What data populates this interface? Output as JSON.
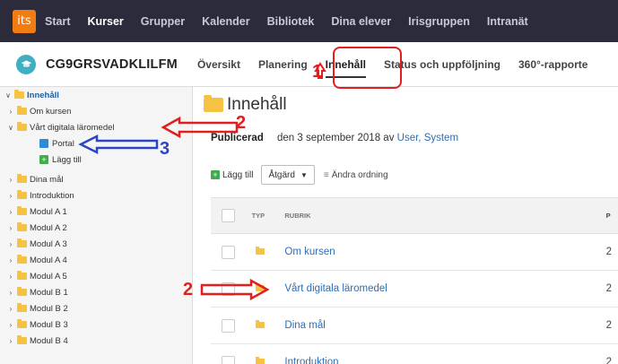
{
  "topnav": {
    "logo": "its",
    "items": [
      {
        "label": "Start",
        "active": false
      },
      {
        "label": "Kurser",
        "active": true
      },
      {
        "label": "Grupper",
        "active": false
      },
      {
        "label": "Kalender",
        "active": false
      },
      {
        "label": "Bibliotek",
        "active": false
      },
      {
        "label": "Dina elever",
        "active": false
      },
      {
        "label": "Irisgruppen",
        "active": false
      },
      {
        "label": "Intranät",
        "active": false
      }
    ]
  },
  "subnav": {
    "course_code": "CG9GRSVADKLILFM",
    "tabs": [
      {
        "label": "Översikt",
        "active": false
      },
      {
        "label": "Planering",
        "active": false
      },
      {
        "label": "Innehåll",
        "active": true
      },
      {
        "label": "Status och uppföljning",
        "active": false
      },
      {
        "label": "360°-rapporte",
        "active": false
      }
    ]
  },
  "sidebar": {
    "root": "Innehåll",
    "items": [
      {
        "label": "Om kursen",
        "indent": 1,
        "type": "folder",
        "expanded": false
      },
      {
        "label": "Vårt digitala läromedel",
        "indent": 1,
        "type": "folder",
        "expanded": true
      },
      {
        "label": "Portal",
        "indent": 2,
        "type": "portal"
      },
      {
        "label": "Lägg till",
        "indent": 2,
        "type": "add"
      },
      {
        "label": "Dina mål",
        "indent": 1,
        "type": "folder",
        "expanded": false
      },
      {
        "label": "Introduktion",
        "indent": 1,
        "type": "folder",
        "expanded": false
      },
      {
        "label": "Modul A 1",
        "indent": 1,
        "type": "folder",
        "expanded": false
      },
      {
        "label": "Modul A 2",
        "indent": 1,
        "type": "folder",
        "expanded": false
      },
      {
        "label": "Modul A 3",
        "indent": 1,
        "type": "folder",
        "expanded": false
      },
      {
        "label": "Modul A 4",
        "indent": 1,
        "type": "folder",
        "expanded": false
      },
      {
        "label": "Modul A 5",
        "indent": 1,
        "type": "folder",
        "expanded": false
      },
      {
        "label": "Modul B 1",
        "indent": 1,
        "type": "folder",
        "expanded": false
      },
      {
        "label": "Modul B 2",
        "indent": 1,
        "type": "folder",
        "expanded": false
      },
      {
        "label": "Modul B 3",
        "indent": 1,
        "type": "folder",
        "expanded": false
      },
      {
        "label": "Modul B 4",
        "indent": 1,
        "type": "folder",
        "expanded": false
      }
    ]
  },
  "main": {
    "title": "Innehåll",
    "published_label": "Publicerad",
    "published_text": "den 3 september 2018 av",
    "published_by": "User, System",
    "toolbar": {
      "add_label": "Lägg till",
      "action_label": "Åtgärd",
      "reorder_label": "Ändra ordning"
    },
    "table": {
      "col_type": "TYP",
      "col_title": "RUBRIK",
      "col_extra": "P",
      "rows": [
        {
          "title": "Om kursen",
          "extra": "2"
        },
        {
          "title": "Vårt digitala läromedel",
          "extra": "2"
        },
        {
          "title": "Dina mål",
          "extra": "2"
        },
        {
          "title": "Introduktion",
          "extra": "2"
        }
      ]
    }
  },
  "annotations": {
    "num_1": "1",
    "num_2_top": "2",
    "num_3": "3",
    "num_2_bottom": "2"
  },
  "colors": {
    "annotation_red": "#e41d1d",
    "annotation_blue": "#2a45c8",
    "link_blue": "#2d6db5",
    "nav_bg": "#2b2b3c",
    "logo_orange": "#f07c12"
  }
}
